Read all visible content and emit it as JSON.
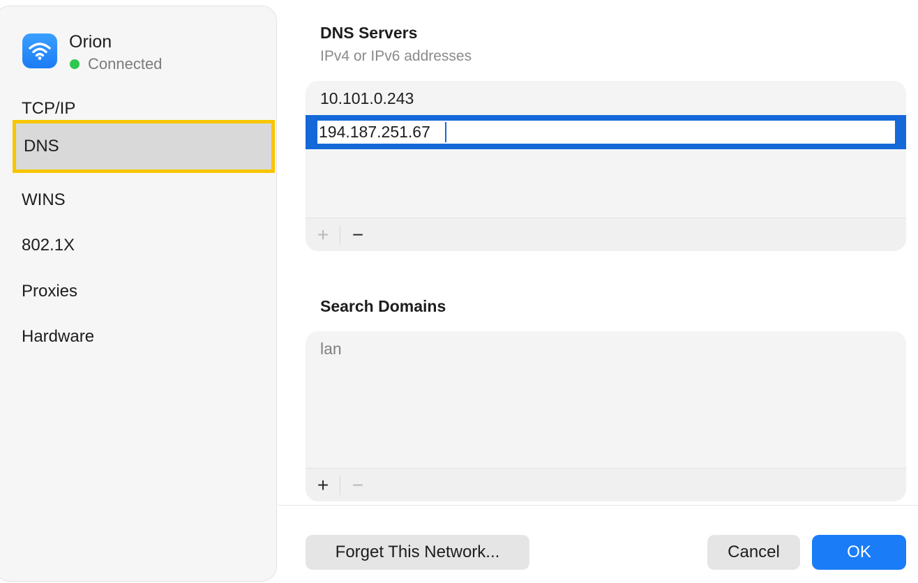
{
  "network": {
    "name": "Orion",
    "status": "Connected",
    "icon": "wifi-icon"
  },
  "sidebar": {
    "items": [
      {
        "label": "TCP/IP"
      },
      {
        "label": "DNS",
        "selected": true
      },
      {
        "label": "WINS"
      },
      {
        "label": "802.1X"
      },
      {
        "label": "Proxies"
      },
      {
        "label": "Hardware"
      }
    ]
  },
  "dns_servers": {
    "title": "DNS Servers",
    "subtitle": "IPv4 or IPv6 addresses",
    "entries": [
      "10.101.0.243"
    ],
    "editing_value": "194.187.251.67",
    "add_label": "+",
    "remove_label": "−"
  },
  "search_domains": {
    "title": "Search Domains",
    "entries": [
      "lan"
    ],
    "add_label": "+",
    "remove_label": "−"
  },
  "footer": {
    "forget_label": "Forget This Network...",
    "cancel_label": "Cancel",
    "ok_label": "OK"
  },
  "colors": {
    "accent": "#1a7cf6",
    "selection_highlight": "#f7c600",
    "status_green": "#2dc84d"
  }
}
